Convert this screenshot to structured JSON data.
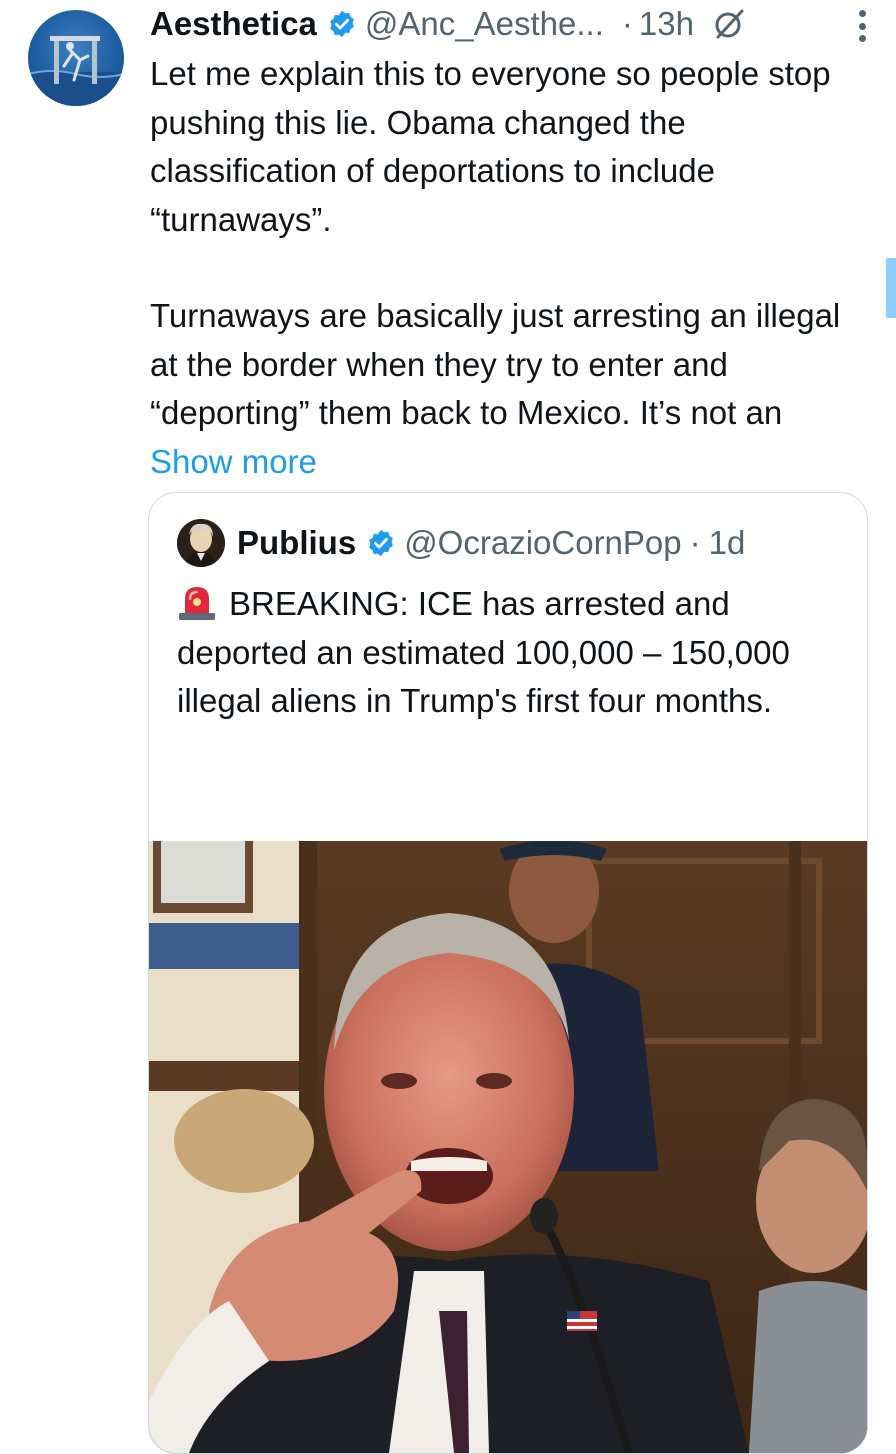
{
  "tweet": {
    "author_name": "Aesthetica",
    "handle": "@Anc_Aesthe...",
    "separator": "·",
    "time": "13h",
    "paragraph_1": "Let me explain this to everyone so people stop pushing this lie. Obama changed the classification of deportations to include “turnaways”.",
    "paragraph_2": "Turnaways are basically just arresting an illegal at the border when they try to enter and “deporting” them back to Mexico. It’s not an",
    "show_more": "Show more",
    "icons": [
      "verified-badge-icon",
      "grok-icon",
      "more-options-icon"
    ]
  },
  "quoted_tweet": {
    "author_name": "Publius",
    "handle": "@OcrazioCornPop",
    "separator": "·",
    "time": "1d",
    "text": "BREAKING: ICE has arrested and deported an estimated 100,000 – 150,000 illegal aliens in Trump's first four months.",
    "truncation": "...",
    "icons": [
      "verified-badge-icon",
      "siren-icon"
    ]
  },
  "colors": {
    "text": "#0f1419",
    "muted": "#536471",
    "link": "#1d9bf0",
    "verified": "#1d9bf0",
    "border": "#cfd9de"
  }
}
